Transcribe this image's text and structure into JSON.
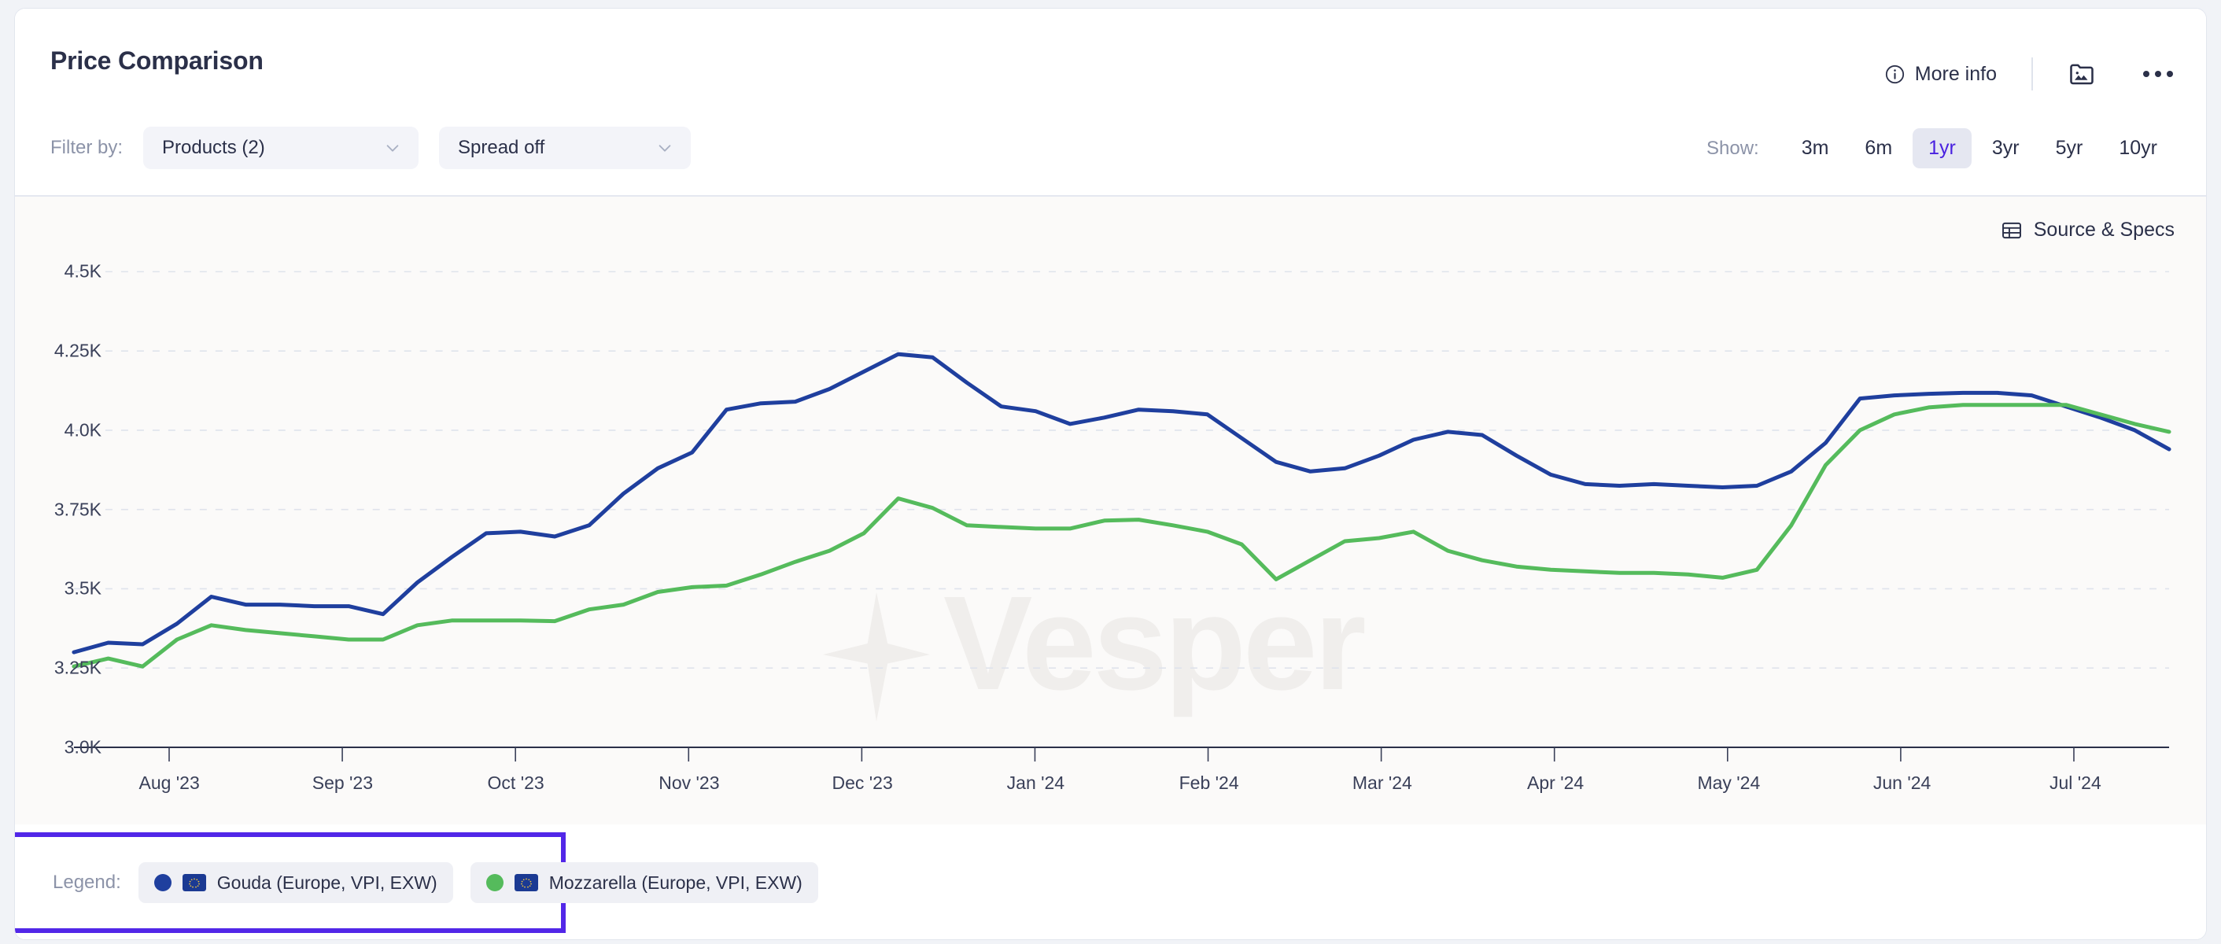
{
  "header": {
    "title": "Price Comparison",
    "more_info": "More info",
    "info_icon": "info-circle-icon",
    "image_icon": "image-folder-icon",
    "menu_icon": "ellipsis-icon"
  },
  "filters": {
    "label": "Filter by:",
    "products": {
      "label": "Products (2)",
      "icon": "chevron-down-icon"
    },
    "spread": {
      "label": "Spread off",
      "icon": "chevron-down-icon"
    }
  },
  "range": {
    "label": "Show:",
    "options": [
      "3m",
      "6m",
      "1yr",
      "3yr",
      "5yr",
      "10yr"
    ],
    "selected": "1yr",
    "accent": "#4a22e0"
  },
  "source_specs": {
    "label": "Source & Specs",
    "icon": "table-icon"
  },
  "watermark": "Vesper",
  "legend": {
    "label": "Legend:",
    "highlight_color": "#5227e8",
    "items": [
      {
        "name": "Gouda (Europe, VPI, EXW)",
        "color": "#1f3f9e",
        "flag": "eu-flag-icon"
      },
      {
        "name": "Mozzarella (Europe, VPI, EXW)",
        "color": "#55bb5c",
        "flag": "eu-flag-icon"
      }
    ]
  },
  "chart_data": {
    "type": "line",
    "title": "Price Comparison",
    "xlabel": "",
    "ylabel": "",
    "ylim": [
      3000,
      4625
    ],
    "yticks": [
      3000,
      3250,
      3500,
      3750,
      4000,
      4250,
      4500
    ],
    "ytick_labels": [
      "3.0K",
      "3.25K",
      "3.5K",
      "3.75K",
      "4.0K",
      "4.25K",
      "4.5K"
    ],
    "xtick_labels": [
      "Aug '23",
      "Sep '23",
      "Oct '23",
      "Nov '23",
      "Dec '23",
      "Jan '24",
      "Feb '24",
      "Mar '24",
      "Apr '24",
      "May '24",
      "Jun '24",
      "Jul '24"
    ],
    "grid": true,
    "legend_position": "bottom",
    "x": [
      0,
      1,
      2,
      3,
      4,
      5,
      6,
      7,
      8,
      9,
      10,
      11,
      12,
      13,
      14,
      15,
      16,
      17,
      18,
      19,
      20,
      21,
      22,
      23,
      24,
      25,
      26,
      27,
      28,
      29,
      30,
      31,
      32,
      33,
      34,
      35,
      36,
      37,
      38,
      39,
      40,
      41,
      42,
      43,
      44,
      45,
      46,
      47,
      48,
      49,
      50,
      51,
      52
    ],
    "series": [
      {
        "name": "Gouda (Europe, VPI, EXW)",
        "color": "#1f3f9e",
        "values": [
          3300,
          3330,
          3325,
          3390,
          3475,
          3450,
          3450,
          3445,
          3445,
          3420,
          3520,
          3600,
          3675,
          3680,
          3665,
          3700,
          3800,
          3880,
          3930,
          4065,
          4085,
          4090,
          4130,
          4185,
          4240,
          4230,
          4150,
          4075,
          4060,
          4020,
          4040,
          4065,
          4060,
          4050,
          3975,
          3900,
          3870,
          3880,
          3920,
          3970,
          3995,
          3985,
          3920,
          3860,
          3830,
          3825,
          3830,
          3825,
          3820,
          3825,
          3870,
          3960,
          4100
        ]
      },
      {
        "name": "Mozzarella (Europe, VPI, EXW)",
        "color": "#55bb5c",
        "values": [
          3255,
          3280,
          3255,
          3340,
          3385,
          3370,
          3360,
          3350,
          3340,
          3340,
          3385,
          3400,
          3400,
          3400,
          3398,
          3435,
          3450,
          3490,
          3505,
          3510,
          3545,
          3585,
          3620,
          3675,
          3785,
          3755,
          3700,
          3695,
          3690,
          3690,
          3715,
          3718,
          3700,
          3680,
          3640,
          3530,
          3590,
          3650,
          3660,
          3680,
          3620,
          3590,
          3570,
          3560,
          3555,
          3550,
          3550,
          3545,
          3535,
          3560,
          3700,
          3890,
          4000
        ]
      }
    ],
    "series_tail": {
      "gouda": [
        4110,
        4115,
        4118,
        4118,
        4110,
        4075,
        4040,
        4000,
        3940
      ],
      "mozzarella": [
        4050,
        4072,
        4080,
        4080,
        4080,
        4080,
        4050,
        4020,
        3995
      ]
    }
  }
}
